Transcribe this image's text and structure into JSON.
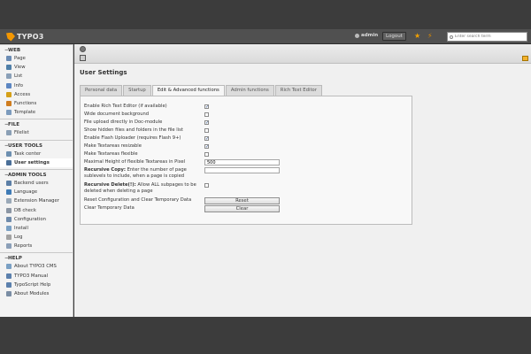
{
  "brand": {
    "name": "TYPO3"
  },
  "header": {
    "username": "admin",
    "logout_label": "Logout",
    "search_placeholder": "Enter search term"
  },
  "menu": {
    "groups": [
      {
        "title": "Web",
        "items": [
          {
            "label": "Page",
            "icon": "page-icon",
            "color": "#6b8cb4"
          },
          {
            "label": "View",
            "icon": "eye-icon",
            "color": "#4f7fa8"
          },
          {
            "label": "List",
            "icon": "list-icon",
            "color": "#8aa0b8"
          },
          {
            "label": "Info",
            "icon": "info-icon",
            "color": "#5c86c2"
          },
          {
            "label": "Access",
            "icon": "key-icon",
            "color": "#d5a018"
          },
          {
            "label": "Functions",
            "icon": "wrench-icon",
            "color": "#d07d1f"
          },
          {
            "label": "Template",
            "icon": "template-icon",
            "color": "#7c9bbd"
          }
        ]
      },
      {
        "title": "File",
        "items": [
          {
            "label": "Filelist",
            "icon": "folder-icon",
            "color": "#8a9fb5"
          }
        ]
      },
      {
        "title": "User tools",
        "items": [
          {
            "label": "Task center",
            "icon": "task-icon",
            "color": "#6d8fb0"
          },
          {
            "label": "User settings",
            "icon": "user-settings-icon",
            "color": "#4a6f98",
            "active": true
          }
        ]
      },
      {
        "title": "Admin tools",
        "items": [
          {
            "label": "Backend users",
            "icon": "users-icon",
            "color": "#5b7ea6"
          },
          {
            "label": "Language",
            "icon": "globe-icon",
            "color": "#3f7bb6"
          },
          {
            "label": "Extension Manager",
            "icon": "extension-icon",
            "color": "#9aa9b8"
          },
          {
            "label": "DB check",
            "icon": "database-icon",
            "color": "#8b96a4"
          },
          {
            "label": "Configuration",
            "icon": "configuration-icon",
            "color": "#6f8bab"
          },
          {
            "label": "Install",
            "icon": "install-icon",
            "color": "#7aa0c4"
          },
          {
            "label": "Log",
            "icon": "log-icon",
            "color": "#a2a2a2"
          },
          {
            "label": "Reports",
            "icon": "reports-icon",
            "color": "#8b9fb8"
          }
        ]
      },
      {
        "title": "Help",
        "items": [
          {
            "label": "About TYPO3 CMS",
            "icon": "about-icon",
            "color": "#7aa0c4"
          },
          {
            "label": "TYPO3 Manual",
            "icon": "manual-icon",
            "color": "#5b80ad"
          },
          {
            "label": "TypoScript Help",
            "icon": "help-icon",
            "color": "#5b80ad"
          },
          {
            "label": "About Modules",
            "icon": "modules-icon",
            "color": "#7a8da4"
          }
        ]
      }
    ]
  },
  "main": {
    "title": "User Settings",
    "tabs": [
      {
        "label": "Personal data",
        "active": false
      },
      {
        "label": "Startup",
        "active": false
      },
      {
        "label": "Edit & Advanced functions",
        "active": true
      },
      {
        "label": "Admin functions",
        "active": false
      },
      {
        "label": "Rich Text Editor",
        "active": false
      }
    ],
    "settings": [
      {
        "label": "Enable Rich Text Editor (if available)",
        "type": "checkbox",
        "checked": true
      },
      {
        "label": "Wide document background",
        "type": "checkbox",
        "checked": false
      },
      {
        "label": "File upload directly in Doc-module",
        "type": "checkbox",
        "checked": true
      },
      {
        "label": "Show hidden files and folders in the file list",
        "type": "checkbox",
        "checked": false
      },
      {
        "label": "Enable Flash Uploader (requires Flash 9+)",
        "type": "checkbox",
        "checked": true
      },
      {
        "label": "Make Textareas resizable",
        "type": "checkbox",
        "checked": true
      },
      {
        "label": "Make Textareas flexible",
        "type": "checkbox",
        "checked": false
      },
      {
        "label": "Maximal Height of flexible Textareas in Pixel",
        "type": "text",
        "value": "500"
      },
      {
        "label_bold": "Recursive Copy:",
        "label": " Enter the number of page sublevels to include, when a page is copied",
        "type": "text",
        "value": ""
      },
      {
        "label_bold": "Recursive Delete(!):",
        "label": " Allow ALL subpages to be deleted when deleting a page",
        "type": "checkbox",
        "checked": false
      },
      {
        "label": "Reset Configuration and Clear Temporary Data",
        "type": "button",
        "button_label": "Reset"
      },
      {
        "label": "Clear Temporary Data",
        "type": "button",
        "button_label": "Clear"
      }
    ]
  }
}
